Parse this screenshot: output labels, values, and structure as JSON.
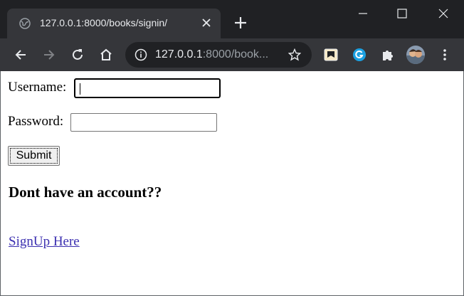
{
  "browser": {
    "tab_title": "127.0.0.1:8000/books/signin/",
    "url_host": "127.0.0.1",
    "url_rest": ":8000/book...",
    "colors": {
      "titlebar": "#202124",
      "toolbar": "#35363a",
      "omnibox": "#202124"
    },
    "icons": [
      "globe-icon",
      "close-icon",
      "plus-icon",
      "minimize-icon",
      "maximize-icon",
      "close-window-icon",
      "back-icon",
      "forward-icon",
      "reload-icon",
      "home-icon",
      "info-icon",
      "star-icon",
      "extension-book-icon",
      "grammarly-icon",
      "puzzle-icon",
      "avatar",
      "kebab-menu-icon"
    ]
  },
  "form": {
    "username_label": "Username:",
    "password_label": "Password:",
    "submit_label": "Submit",
    "heading": "Dont have an account??",
    "signup_link": "SignUp Here",
    "link_color": "#3b2fb0"
  }
}
